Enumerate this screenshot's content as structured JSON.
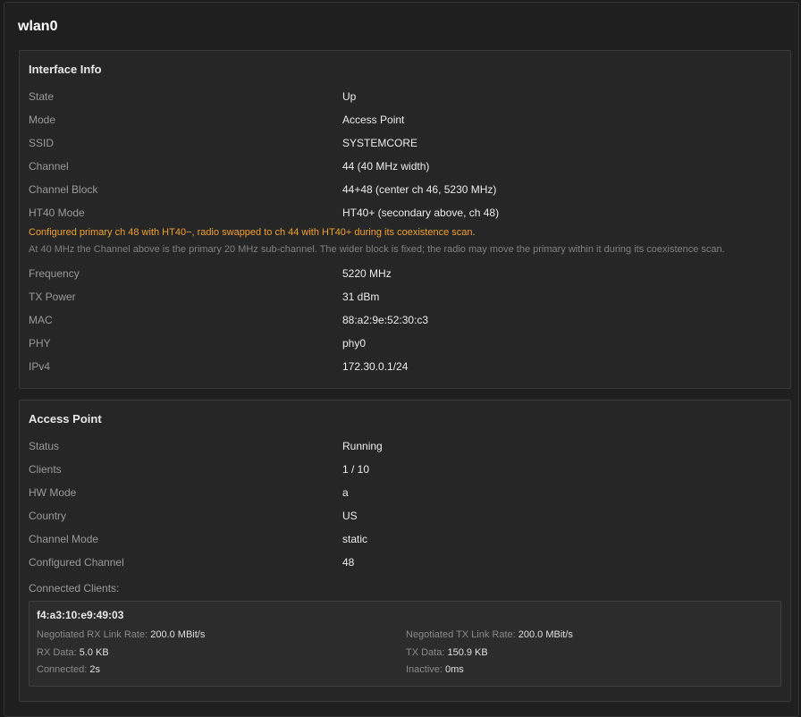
{
  "interface_name": "wlan0",
  "interface_info": {
    "title": "Interface Info",
    "rows_top": [
      {
        "key": "State",
        "value": "Up"
      },
      {
        "key": "Mode",
        "value": "Access Point"
      },
      {
        "key": "SSID",
        "value": "SYSTEMCORE"
      },
      {
        "key": "Channel",
        "value": "44 (40 MHz width)"
      },
      {
        "key": "Channel Block",
        "value": "44+48 (center ch 46, 5230 MHz)"
      },
      {
        "key": "HT40 Mode",
        "value": "HT40+ (secondary above, ch 48)"
      }
    ],
    "warning": "Configured primary ch 48 with HT40−, radio swapped to ch 44 with HT40+ during its coexistence scan.",
    "note": "At 40 MHz the Channel above is the primary 20 MHz sub-channel. The wider block is fixed; the radio may move the primary within it during its coexistence scan.",
    "rows_bottom": [
      {
        "key": "Frequency",
        "value": "5220 MHz"
      },
      {
        "key": "TX Power",
        "value": "31 dBm"
      },
      {
        "key": "MAC",
        "value": "88:a2:9e:52:30:c3"
      },
      {
        "key": "PHY",
        "value": "phy0"
      },
      {
        "key": "IPv4",
        "value": "172.30.0.1/24"
      }
    ]
  },
  "access_point": {
    "title": "Access Point",
    "rows": [
      {
        "key": "Status",
        "value": "Running"
      },
      {
        "key": "Clients",
        "value": "1 / 10"
      },
      {
        "key": "HW Mode",
        "value": "a"
      },
      {
        "key": "Country",
        "value": "US"
      },
      {
        "key": "Channel Mode",
        "value": "static"
      },
      {
        "key": "Configured Channel",
        "value": "48"
      }
    ],
    "clients_label": "Connected Clients:",
    "clients": [
      {
        "mac": "f4:a3:10:e9:49:03",
        "rx_rate_label": "Negotiated RX Link Rate:",
        "rx_rate": "200.0 MBit/s",
        "tx_rate_label": "Negotiated TX Link Rate:",
        "tx_rate": "200.0 MBit/s",
        "rx_data_label": "RX Data:",
        "rx_data": "5.0 KB",
        "tx_data_label": "TX Data:",
        "tx_data": "150.9 KB",
        "connected_label": "Connected:",
        "connected": "2s",
        "inactive_label": "Inactive:",
        "inactive": "0ms"
      }
    ]
  }
}
